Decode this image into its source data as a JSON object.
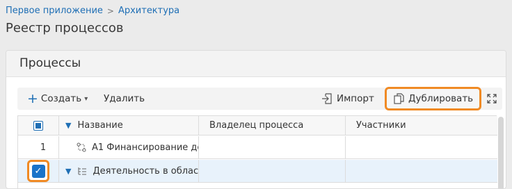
{
  "breadcrumb": {
    "items": [
      "Первое приложение",
      "Архитектура"
    ],
    "separator": ">"
  },
  "page": {
    "title": "Реестр процессов"
  },
  "panel": {
    "title": "Процессы"
  },
  "toolbar": {
    "create_label": "Создать",
    "delete_label": "Удалить",
    "import_label": "Импорт",
    "duplicate_label": "Дублировать"
  },
  "table": {
    "columns": [
      "Название",
      "Владелец процесса",
      "Участники"
    ],
    "rows": [
      {
        "index": "1",
        "name": "А1 Финансирование де",
        "owner": "",
        "participants": ""
      },
      {
        "index": "",
        "name": "Деятельность в области",
        "owner": "",
        "participants": "",
        "selected": true
      }
    ]
  },
  "colors": {
    "accent": "#1f6fb5",
    "highlight": "#f08a24",
    "selected_row": "#e8f2fb"
  },
  "icons": [
    "plus-icon",
    "chevron-down-icon",
    "import-icon",
    "duplicate-icon",
    "expand-icon",
    "process-icon",
    "list-tree-icon",
    "checkbox-icon"
  ]
}
